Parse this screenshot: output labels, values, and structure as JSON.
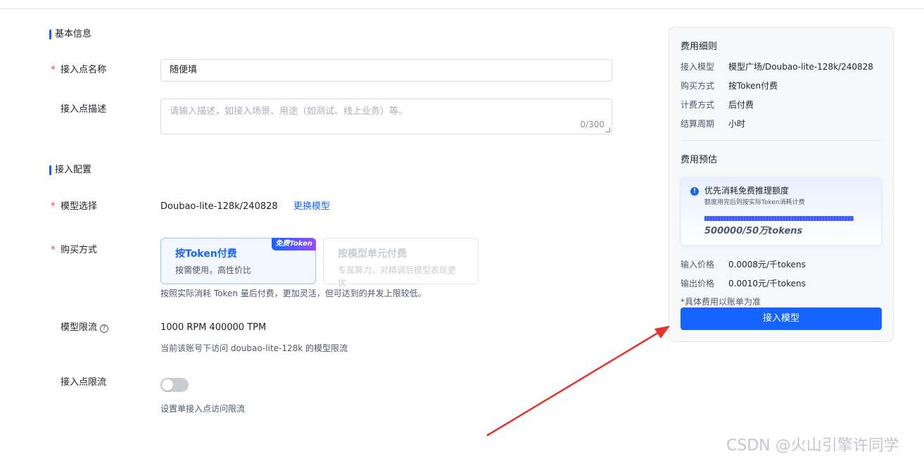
{
  "form": {
    "basic_section": "基本信息",
    "endpoint_name_label": "接入点名称",
    "endpoint_name_value": "随便填",
    "endpoint_desc_label": "接入点描述",
    "endpoint_desc_placeholder": "请输入描述，如接入场景、用途（如测试、线上业务）等。",
    "endpoint_desc_count": "0/300",
    "config_section": "接入配置",
    "model_label": "模型选择",
    "model_value": "Doubao-lite-128k/240828",
    "change_model": "更换模型",
    "purchase_label": "购买方式",
    "purchase_options": [
      {
        "title": "按Token付费",
        "sub": "按需使用，高性价比",
        "badge": "免费Token",
        "selected": true
      },
      {
        "title": "按模型单元付费",
        "sub": "专属算力，对精调后模型表现更优",
        "selected": false
      }
    ],
    "purchase_hint": "按照实际消耗 Token 量后付费，更加灵活，但可达到的并发上限较低。",
    "rate_limit_label": "模型限流",
    "rate_limit_value": "1000 RPM 400000 TPM",
    "rate_limit_hint": "当前该账号下访问 doubao-lite-128k 的模型限流",
    "endpoint_limit_label": "接入点限流",
    "endpoint_limit_enabled": false,
    "endpoint_limit_hint": "设置单接入点访问限流",
    "required_mark": "*"
  },
  "panel": {
    "fee_title": "费用细则",
    "fee_rows": [
      {
        "key": "接入模型",
        "value": "模型广场/Doubao-lite-128k/240828"
      },
      {
        "key": "购买方式",
        "value": "按Token付费"
      },
      {
        "key": "计费方式",
        "value": "后付费"
      },
      {
        "key": "结算周期",
        "value": "小时"
      }
    ],
    "estimate_title": "费用预估",
    "quota_title": "优先消耗免费推理额度",
    "quota_sub": "额度用完后则按实际Token消耗计费",
    "quota_value": "500000/50万tokens",
    "quota_remaining_fraction": 1.0,
    "price_rows": [
      {
        "key": "输入价格",
        "value": "0.0008元/千tokens"
      },
      {
        "key": "输出价格",
        "value": "0.0010元/千tokens"
      }
    ],
    "note": "*具体费用以账单为准",
    "submit": "接入模型"
  },
  "watermark": "CSDN @火山引擎许同学",
  "colors": {
    "accent": "#1664ff",
    "required": "#f53f3f",
    "annotation_arrow": "#e8312a"
  }
}
